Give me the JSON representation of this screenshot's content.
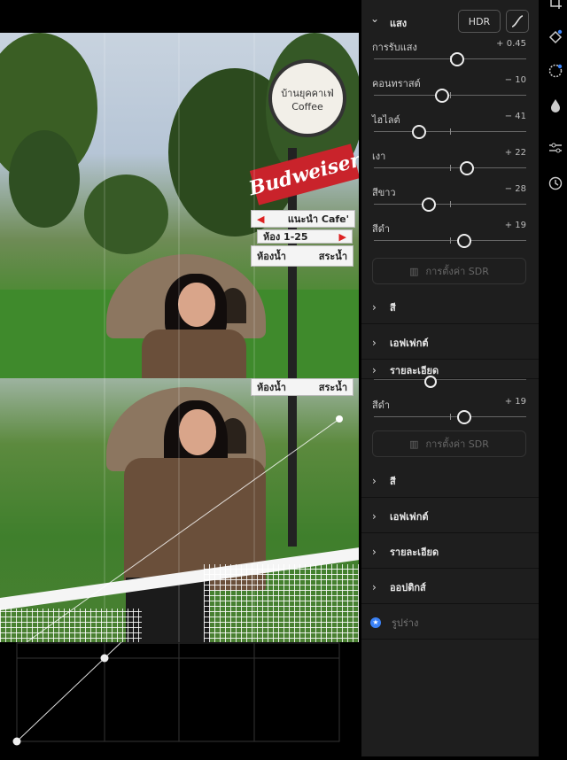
{
  "panel": {
    "light_section": {
      "label": "แสง",
      "hdr_label": "HDR",
      "sliders": [
        {
          "name": "การรับแสง",
          "value_text": "+ 0.45",
          "value": 0.45,
          "min": -5,
          "max": 5
        },
        {
          "name": "คอนทราสต์",
          "value_text": "− 10",
          "value": -10,
          "min": -100,
          "max": 100
        },
        {
          "name": "ไฮไลต์",
          "value_text": "− 41",
          "value": -41,
          "min": -100,
          "max": 100
        },
        {
          "name": "เงา",
          "value_text": "+ 22",
          "value": 22,
          "min": -100,
          "max": 100
        },
        {
          "name": "สีขาว",
          "value_text": "− 28",
          "value": -28,
          "min": -100,
          "max": 100
        },
        {
          "name": "สีดำ",
          "value_text": "+ 19",
          "value": 19,
          "min": -100,
          "max": 100
        }
      ],
      "sdr_label": "การตั้งค่า SDR"
    },
    "sections_top": [
      {
        "label": "สี"
      },
      {
        "label": "เอฟเฟกต์"
      },
      {
        "label": "รายละเอียด"
      }
    ],
    "dup": {
      "slider": {
        "name": "สีดำ",
        "value_text": "+ 19",
        "value": 19,
        "min": -100,
        "max": 100
      },
      "sdr_label": "การตั้งค่า SDR"
    },
    "sections_bottom": [
      {
        "label": "สี"
      },
      {
        "label": "เอฟเฟกต์"
      },
      {
        "label": "รายละเอียด"
      },
      {
        "label": "ออปติกส์"
      }
    ],
    "geometry_label": "รูปร่าง"
  },
  "photo": {
    "sign_red_text": "Budweiser",
    "sign_circle_text": "บ้านยุคคาเฟ่ Coffee",
    "sign_white_1": "แนะนำ Cafe'",
    "sign_white_2": "ห้อง 1-25",
    "sign_white_3a": "ห้องน้ำ",
    "sign_white_3b": "สระน้ำ",
    "sign_white_4a": "ห้องน้ำ",
    "sign_white_4b": "สระน้ำ"
  },
  "accent": {
    "geometry_dot": "#3b82f6",
    "panel_bg": "#1e1e1e"
  }
}
